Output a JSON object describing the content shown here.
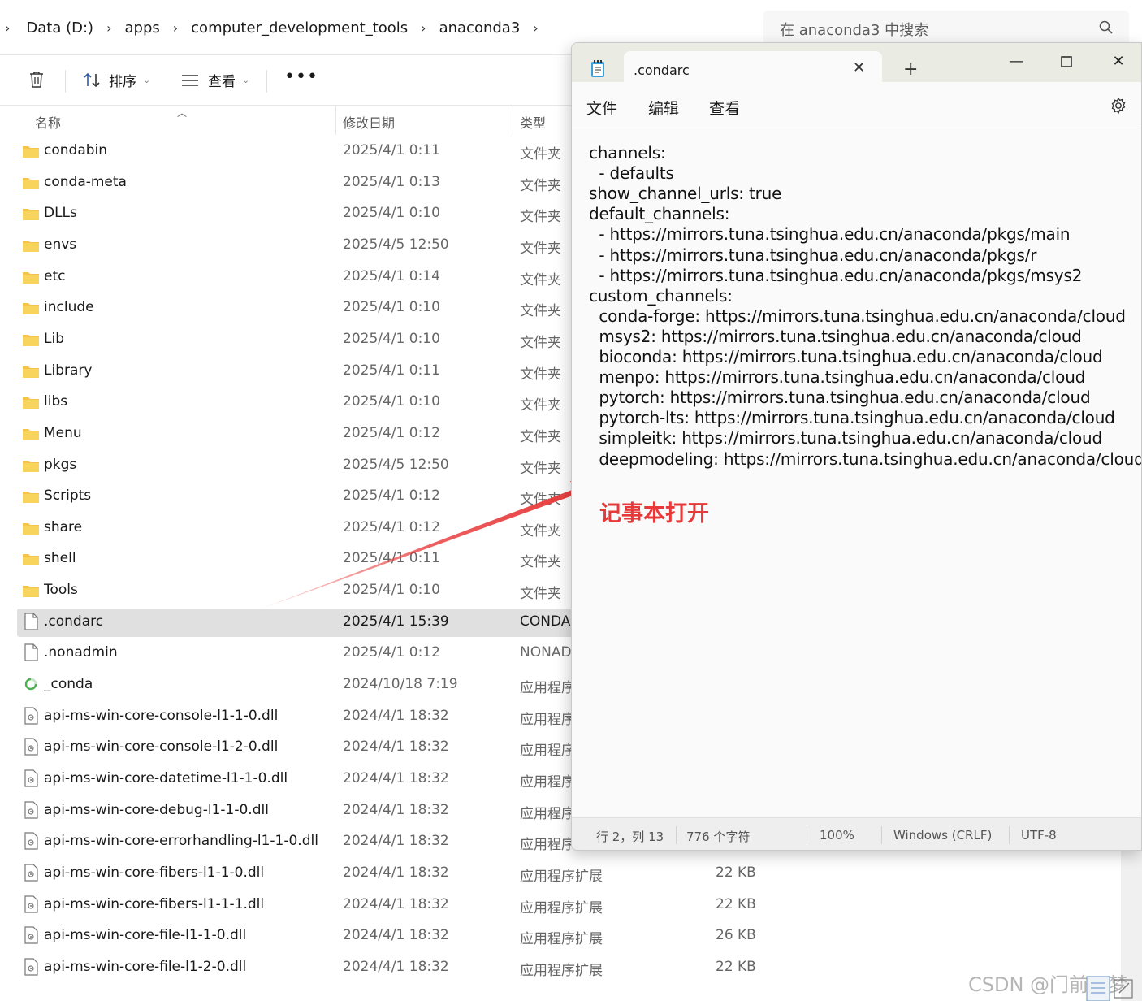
{
  "explorer": {
    "breadcrumb": [
      "Data (D:)",
      "apps",
      "computer_development_tools",
      "anaconda3"
    ],
    "search_placeholder": "在 anaconda3 中搜索",
    "toolbar": {
      "sort_label": "排序",
      "view_label": "查看"
    },
    "columns": {
      "name": "名称",
      "modified": "修改日期",
      "type": "类型"
    },
    "files": [
      {
        "icon": "folder-icon",
        "name": "condabin",
        "date": "2025/4/1 0:11",
        "type": "文件夹",
        "size": ""
      },
      {
        "icon": "folder-icon",
        "name": "conda-meta",
        "date": "2025/4/1 0:13",
        "type": "文件夹",
        "size": ""
      },
      {
        "icon": "folder-icon",
        "name": "DLLs",
        "date": "2025/4/1 0:10",
        "type": "文件夹",
        "size": ""
      },
      {
        "icon": "folder-icon",
        "name": "envs",
        "date": "2025/4/5 12:50",
        "type": "文件夹",
        "size": ""
      },
      {
        "icon": "folder-icon",
        "name": "etc",
        "date": "2025/4/1 0:14",
        "type": "文件夹",
        "size": ""
      },
      {
        "icon": "folder-icon",
        "name": "include",
        "date": "2025/4/1 0:10",
        "type": "文件夹",
        "size": ""
      },
      {
        "icon": "folder-icon",
        "name": "Lib",
        "date": "2025/4/1 0:10",
        "type": "文件夹",
        "size": ""
      },
      {
        "icon": "folder-icon",
        "name": "Library",
        "date": "2025/4/1 0:11",
        "type": "文件夹",
        "size": ""
      },
      {
        "icon": "folder-icon",
        "name": "libs",
        "date": "2025/4/1 0:10",
        "type": "文件夹",
        "size": ""
      },
      {
        "icon": "folder-icon",
        "name": "Menu",
        "date": "2025/4/1 0:12",
        "type": "文件夹",
        "size": ""
      },
      {
        "icon": "folder-icon",
        "name": "pkgs",
        "date": "2025/4/5 12:50",
        "type": "文件夹",
        "size": ""
      },
      {
        "icon": "folder-icon",
        "name": "Scripts",
        "date": "2025/4/1 0:12",
        "type": "文件夹",
        "size": ""
      },
      {
        "icon": "folder-icon",
        "name": "share",
        "date": "2025/4/1 0:12",
        "type": "文件夹",
        "size": ""
      },
      {
        "icon": "folder-icon",
        "name": "shell",
        "date": "2025/4/1 0:11",
        "type": "文件夹",
        "size": ""
      },
      {
        "icon": "folder-icon",
        "name": "Tools",
        "date": "2025/4/1 0:10",
        "type": "文件夹",
        "size": ""
      },
      {
        "icon": "file-icon",
        "name": ".condarc",
        "date": "2025/4/1 15:39",
        "type": "CONDA",
        "size": "",
        "selected": true
      },
      {
        "icon": "file-icon",
        "name": ".nonadmin",
        "date": "2025/4/1 0:12",
        "type": "NONAD",
        "size": ""
      },
      {
        "icon": "loading-icon",
        "name": "_conda",
        "date": "2024/10/18 7:19",
        "type": "应用程序",
        "size": ""
      },
      {
        "icon": "dll-icon",
        "name": "api-ms-win-core-console-l1-1-0.dll",
        "date": "2024/4/1 18:32",
        "type": "应用程序",
        "size": ""
      },
      {
        "icon": "dll-icon",
        "name": "api-ms-win-core-console-l1-2-0.dll",
        "date": "2024/4/1 18:32",
        "type": "应用程序",
        "size": ""
      },
      {
        "icon": "dll-icon",
        "name": "api-ms-win-core-datetime-l1-1-0.dll",
        "date": "2024/4/1 18:32",
        "type": "应用程序",
        "size": ""
      },
      {
        "icon": "dll-icon",
        "name": "api-ms-win-core-debug-l1-1-0.dll",
        "date": "2024/4/1 18:32",
        "type": "应用程序",
        "size": ""
      },
      {
        "icon": "dll-icon",
        "name": "api-ms-win-core-errorhandling-l1-1-0.dll",
        "date": "2024/4/1 18:32",
        "type": "应用程序",
        "size": ""
      },
      {
        "icon": "dll-icon",
        "name": "api-ms-win-core-fibers-l1-1-0.dll",
        "date": "2024/4/1 18:32",
        "type": "应用程序扩展",
        "size": "22 KB"
      },
      {
        "icon": "dll-icon",
        "name": "api-ms-win-core-fibers-l1-1-1.dll",
        "date": "2024/4/1 18:32",
        "type": "应用程序扩展",
        "size": "22 KB"
      },
      {
        "icon": "dll-icon",
        "name": "api-ms-win-core-file-l1-1-0.dll",
        "date": "2024/4/1 18:32",
        "type": "应用程序扩展",
        "size": "26 KB"
      },
      {
        "icon": "dll-icon",
        "name": "api-ms-win-core-file-l1-2-0.dll",
        "date": "2024/4/1 18:32",
        "type": "应用程序扩展",
        "size": "22 KB"
      }
    ]
  },
  "notepad": {
    "tab_title": ".condarc",
    "menu": [
      "文件",
      "编辑",
      "查看"
    ],
    "content_lines": [
      "channels:",
      "  - defaults",
      "show_channel_urls: true",
      "default_channels:",
      "  - https://mirrors.tuna.tsinghua.edu.cn/anaconda/pkgs/main",
      "  - https://mirrors.tuna.tsinghua.edu.cn/anaconda/pkgs/r",
      "  - https://mirrors.tuna.tsinghua.edu.cn/anaconda/pkgs/msys2",
      "custom_channels:",
      "  conda-forge: https://mirrors.tuna.tsinghua.edu.cn/anaconda/cloud",
      "  msys2: https://mirrors.tuna.tsinghua.edu.cn/anaconda/cloud",
      "  bioconda: https://mirrors.tuna.tsinghua.edu.cn/anaconda/cloud",
      "  menpo: https://mirrors.tuna.tsinghua.edu.cn/anaconda/cloud",
      "  pytorch: https://mirrors.tuna.tsinghua.edu.cn/anaconda/cloud",
      "  pytorch-lts: https://mirrors.tuna.tsinghua.edu.cn/anaconda/cloud",
      "  simpleitk: https://mirrors.tuna.tsinghua.edu.cn/anaconda/cloud",
      "  deepmodeling: https://mirrors.tuna.tsinghua.edu.cn/anaconda/cloud/"
    ],
    "annotation": "记事本打开",
    "status": {
      "position": "行 2，列 13",
      "chars": "776 个字符",
      "zoom": "100%",
      "line_ending": "Windows (CRLF)",
      "encoding": "UTF-8"
    }
  },
  "annotation_color": "#e8393a",
  "watermark": "CSDN @门前云梦"
}
